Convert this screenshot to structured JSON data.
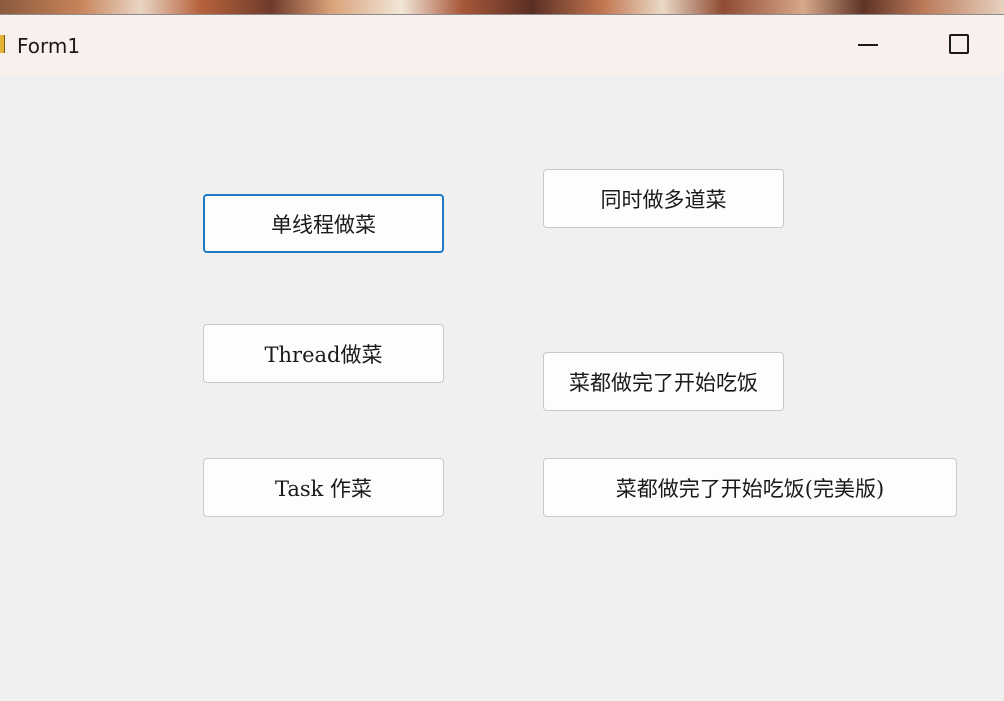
{
  "window": {
    "title": "Form1",
    "minimize_icon": "minimize-icon",
    "maximize_icon": "maximize-icon",
    "app_icon": "form-app-icon",
    "accent": "#1c7ac9",
    "titlebar_bg": "#f9efed",
    "client_bg": "#f0f0f0"
  },
  "buttons": {
    "single_thread": "单线程做菜",
    "multi_dishes": "同时做多道菜",
    "thread_cook": "Thread做菜",
    "eat_when_done": "菜都做完了开始吃饭",
    "task_cook": "Task 作菜",
    "eat_when_done_full": "菜都做完了开始吃饭(完美版)"
  }
}
